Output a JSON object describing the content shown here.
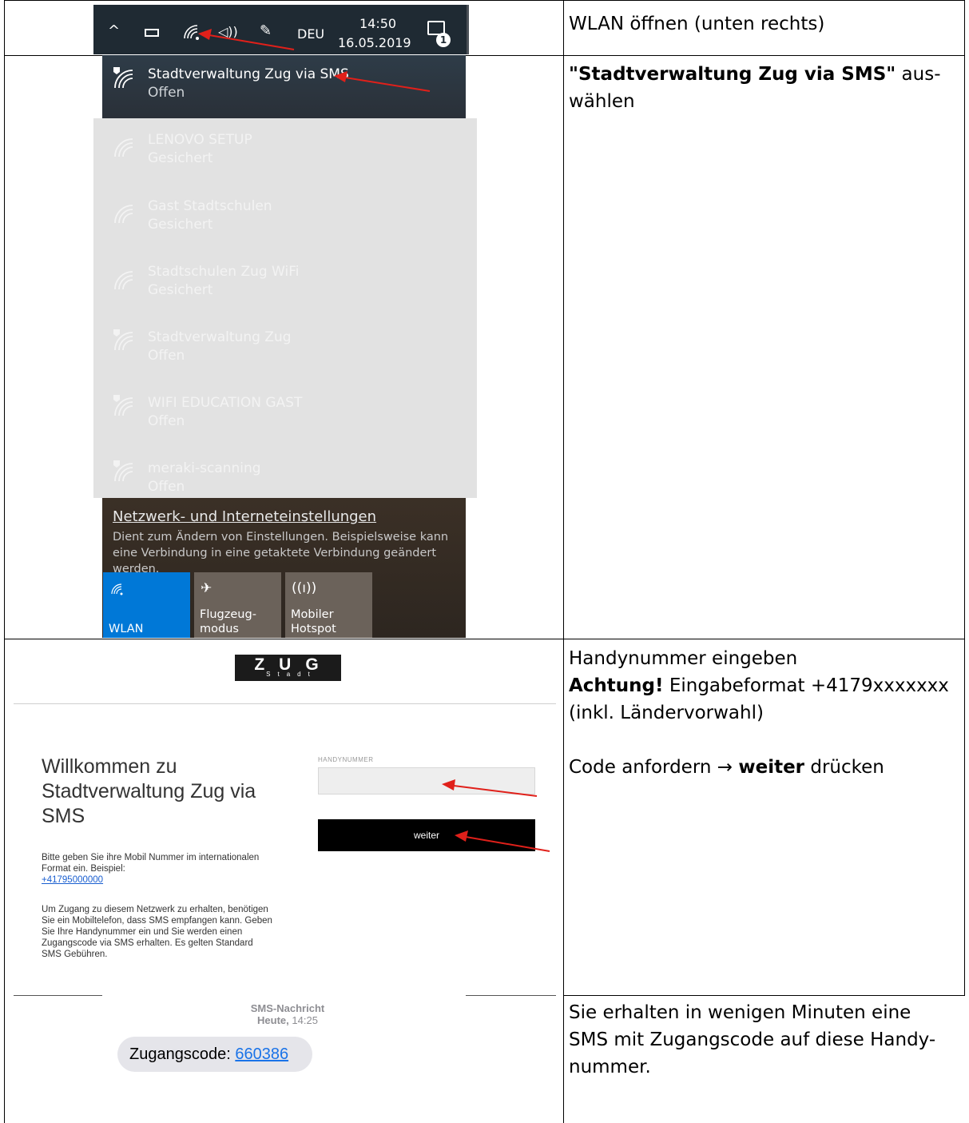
{
  "rows": [
    {
      "description": "WLAN öffnen (unten rechts)"
    },
    {
      "description_bold": "\"Stadtverwaltung Zug via SMS\"",
      "description_rest_1": " aus-",
      "description_rest_2": "wählen"
    },
    {
      "description_line1": "Handynummer eingeben",
      "description_bold": "Achtung!",
      "description_line2": " Eingabeformat +4179xxxxxxx",
      "description_line3": "(inkl. Ländervorwahl)",
      "description_line4_a": "Code anfordern → ",
      "description_line4_b": "weiter",
      "description_line4_c": " drücken"
    },
    {
      "description_line1": "Sie erhalten in wenigen Minuten eine",
      "description_line2": "SMS mit Zugangscode auf diese Handy-",
      "description_line3": "nummer."
    }
  ],
  "taskbar": {
    "language": "DEU",
    "time": "14:50",
    "date": "16.05.2019",
    "notification_count": "1"
  },
  "wlan_flyout": {
    "selected_network": {
      "name": "Stadtverwaltung Zug via SMS",
      "status": "Offen"
    },
    "networks": [
      {
        "name": "LENOVO SETUP",
        "status": "Gesichert"
      },
      {
        "name": "Gast Stadtschulen",
        "status": "Gesichert"
      },
      {
        "name": "Stadtschulen Zug WiFi",
        "status": "Gesichert"
      },
      {
        "name": "Stadtverwaltung Zug",
        "status": "Offen"
      },
      {
        "name": "WIFI EDUCATION GAST",
        "status": "Offen"
      },
      {
        "name": "meraki-scanning",
        "status": "Offen"
      }
    ],
    "settings_link": "Netzwerk- und Interneteinstellungen",
    "settings_desc": "Dient zum Ändern von Einstellungen. Beispielsweise kann eine Verbindung in eine getaktete Verbindung geändert werden.",
    "quick_actions": [
      {
        "line1": "WLAN",
        "line2": ""
      },
      {
        "line1": "Flugzeug-",
        "line2": "modus"
      },
      {
        "line1": "Mobiler",
        "line2": "Hotspot"
      }
    ],
    "wlan_tile_color": "#0078d7"
  },
  "portal": {
    "logo_big": "ZUG",
    "logo_small": "Stadt",
    "welcome": "Willkommen zu Stadtverwaltung Zug via SMS",
    "intro": "Bitte geben Sie ihre Mobil Nummer im internationalen Format ein. Beispiel:",
    "example_number": "+41795000000",
    "info": "Um Zugang zu diesem Netzwerk zu erhalten, benötigen Sie ein Mobiltelefon, dass SMS empfangen kann. Geben Sie Ihre Handynummer ein und Sie werden einen Zugangscode via SMS erhalten. Es gelten Standard SMS Gebühren.",
    "field_label": "HANDYNUMMER",
    "field_value": "",
    "button_label": "weiter"
  },
  "sms": {
    "header": "SMS-Nachricht",
    "day": "Heute,",
    "time": "14:25",
    "message_prefix": "Zugangscode: ",
    "code": "660386"
  },
  "colors": {
    "arrow": "#e0201a",
    "link": "#1a73e8"
  }
}
